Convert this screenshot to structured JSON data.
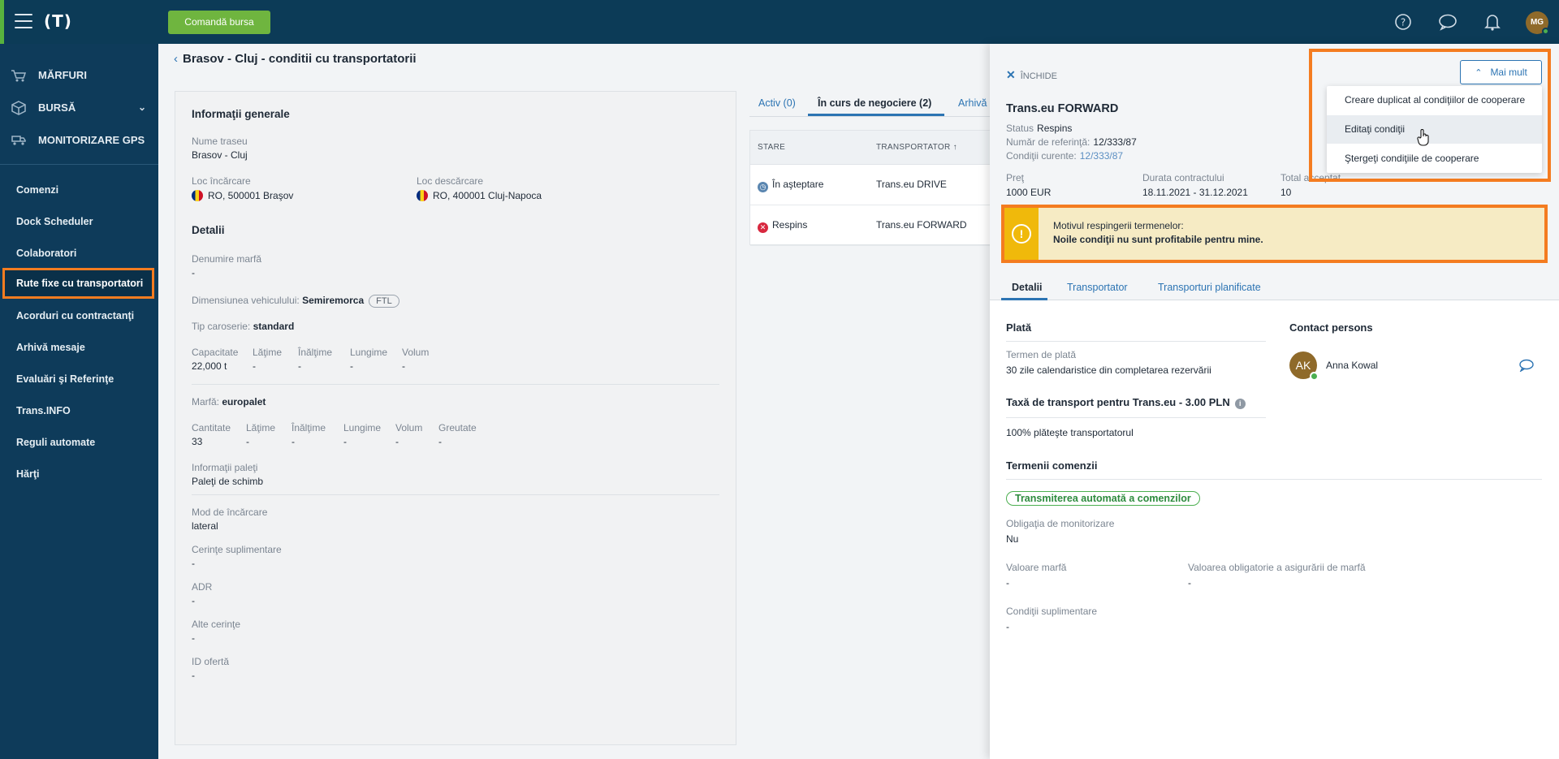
{
  "topbar": {
    "logo": "(T)",
    "cta_label": "Comandă bursa",
    "avatar_initials": "MG",
    "icons": [
      "help-icon",
      "chat-icon",
      "bell-icon"
    ]
  },
  "sidebar": {
    "main": [
      {
        "label": "MĂRFURI",
        "icon": "cart-icon"
      },
      {
        "label": "BURSĂ",
        "icon": "box-icon"
      },
      {
        "label": "MONITORIZARE GPS",
        "icon": "gps-truck-icon"
      }
    ],
    "items": [
      {
        "label": "Comenzi"
      },
      {
        "label": "Dock Scheduler"
      },
      {
        "label": "Colaboratori"
      },
      {
        "label": "Rute fixe cu transportatori"
      },
      {
        "label": "Acorduri cu contractanţi"
      },
      {
        "label": "Arhivă mesaje"
      },
      {
        "label": "Evaluări şi Referinţe"
      },
      {
        "label": "Trans.INFO"
      },
      {
        "label": "Reguli automate"
      },
      {
        "label": "Hărţi"
      }
    ]
  },
  "page": {
    "title": "Brasov - Cluj - conditii cu transportatorii",
    "back_icon": "chevron-left-icon"
  },
  "info": {
    "general_heading": "Informaţii generale",
    "route_label": "Nume traseu",
    "route_value": "Brasov - Cluj",
    "load_label": "Loc încărcare",
    "load_value": "RO, 500001 Braşov",
    "unload_label": "Loc descărcare",
    "unload_value": "RO, 400001 Cluj-Napoca",
    "details_heading": "Detalii",
    "goods_name_label": "Denumire marfă",
    "goods_name_value": "-",
    "vehicle_size_label": "Dimensiunea vehiculului:",
    "vehicle_size_value": "Semiremorca",
    "vehicle_size_tag": "FTL",
    "body_type_label": "Tip caroserie:",
    "body_type_value": "standard",
    "capacity": {
      "headers": [
        "Capacitate",
        "Lăţime",
        "Înălţime",
        "Lungime",
        "Volum"
      ],
      "values": [
        "22,000 t",
        "-",
        "-",
        "-",
        "-"
      ]
    },
    "goods_label": "Marfă:",
    "goods_value": "europalet",
    "quantity": {
      "headers": [
        "Cantitate",
        "Lăţime",
        "Înălţime",
        "Lungime",
        "Volum",
        "Greutate"
      ],
      "values": [
        "33",
        "-",
        "-",
        "-",
        "-",
        "-"
      ]
    },
    "pallets_label": "Informaţii paleţi",
    "pallets_value": "Paleţi de schimb",
    "loading_mode_label": "Mod de încărcare",
    "loading_mode_value": "lateral",
    "extra_req_label": "Cerinţe suplimentare",
    "extra_req_value": "-",
    "adr_label": "ADR",
    "adr_value": "-",
    "other_req_label": "Alte cerinţe",
    "other_req_value": "-",
    "offer_id_label": "ID ofertă",
    "offer_id_value": "-"
  },
  "mid": {
    "tabs": [
      "Activ (0)",
      "În curs de negociere (2)",
      "Arhivă"
    ],
    "table_headers": [
      "STARE",
      "TRANSPORTATOR ↑"
    ],
    "rows": [
      {
        "status": "În aşteptare",
        "carrier": "Trans.eu DRIVE",
        "status_icon": "clock-icon"
      },
      {
        "status": "Respins",
        "carrier": "Trans.eu FORWARD",
        "status_icon": "reject-icon"
      }
    ]
  },
  "panel": {
    "close_label": "ÎNCHIDE",
    "carrier_name": "Trans.eu FORWARD",
    "status_label": "Status",
    "status_value": "Respins",
    "ref_label": "Număr de referinţă:",
    "ref_value": "12/333/87",
    "current_label": "Condiţii curente:",
    "current_value": "12/333/87",
    "price_label": "Preţ",
    "price_value": "1000 EUR",
    "duration_label": "Durata contractului",
    "duration_value": "18.11.2021 - 31.12.2021",
    "total_label": "Total acceptat",
    "total_value": "10",
    "rejection_title": "Motivul respingerii termenelor:",
    "rejection_reason": "Noile condiţii nu sunt profitabile pentru mine.",
    "tabs": [
      "Detalii",
      "Transportator",
      "Transporturi planificate"
    ],
    "payment_heading": "Plată",
    "payment_term_label": "Termen de plată",
    "payment_term_value": "30 zile calendaristice din completarea rezervării",
    "fee_heading": "Taxă de transport pentru Trans.eu - 3.00 PLN",
    "fee_value": "100% plăteşte transportatorul",
    "contact_heading": "Contact persons",
    "contact_initials": "AK",
    "contact_name": "Anna Kowal",
    "order_terms_heading": "Termenii comenzii",
    "auto_tag": "Transmiterea automată a comenzilor",
    "monitoring_label": "Obligaţia de monitorizare",
    "monitoring_value": "Nu",
    "goods_value_label": "Valoare marfă",
    "goods_value_value": "-",
    "insurance_label": "Valoarea obligatorie a asigurării de marfă",
    "insurance_value": "-",
    "additional_label": "Condiţii suplimentare",
    "additional_value": "-"
  },
  "more_menu": {
    "button_label": "Mai mult",
    "items": [
      "Creare duplicat al condiţiilor de cooperare",
      "Editaţi condiţii",
      "Ştergeţi condiţiile de cooperare"
    ]
  },
  "colors": {
    "topbar": "#0c3b57",
    "sidebar": "#0e3b5a",
    "accent": "#2c74b3",
    "highlight": "#f47c20",
    "cta": "#6fb53f"
  }
}
